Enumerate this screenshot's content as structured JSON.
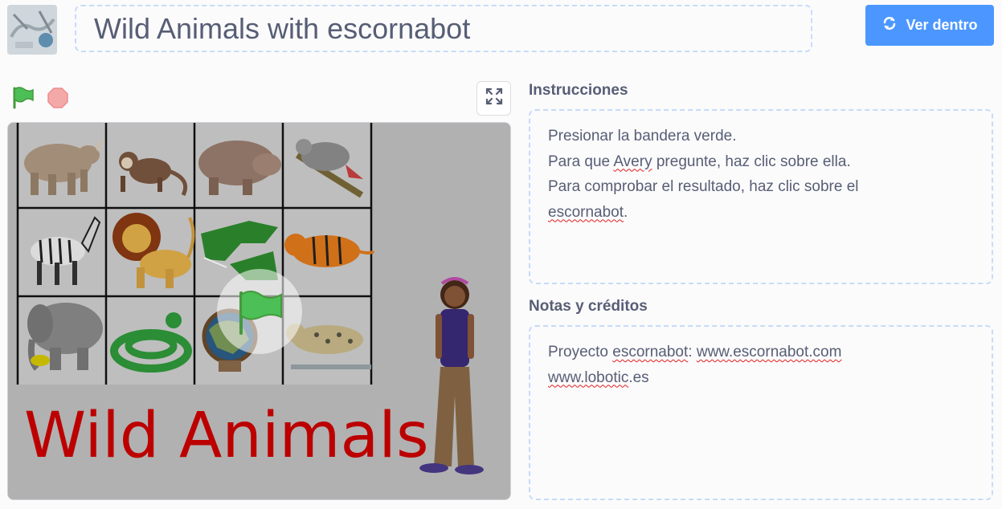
{
  "project": {
    "title": "Wild Animals with escornabot",
    "see_inside_label": "Ver dentro"
  },
  "player": {
    "green_flag_icon": "green-flag-icon",
    "stop_icon": "stop-icon",
    "fullscreen_icon": "fullscreen-icon",
    "stage_caption": "Wild Animals",
    "grid_animals": [
      "rhinoceros",
      "monkey",
      "hippopotamus",
      "parrot",
      "zebra",
      "lion",
      "crocodile",
      "tiger",
      "elephant",
      "snake",
      "globe",
      "leopard"
    ],
    "sprite": "Avery"
  },
  "instructions": {
    "heading": "Instrucciones",
    "lines": [
      {
        "pre": "Presionar la bandera verde.",
        "mark": "",
        "post": ""
      },
      {
        "pre": "Para que ",
        "mark": "Avery",
        "post": " pregunte, haz clic sobre ella."
      },
      {
        "pre": "Para comprobar el resultado, haz clic sobre el",
        "mark": "",
        "post": ""
      },
      {
        "pre": "",
        "mark": "escornabot",
        "post": "."
      }
    ]
  },
  "notes": {
    "heading": "Notas y créditos",
    "line1_pre": "Proyecto ",
    "line1_mark1": "escornabot",
    "line1_mid": ": ",
    "line1_mark2": "www.escornabot.com",
    "line2_mark": "www.lobotic",
    "line2_post": ".es"
  },
  "colors": {
    "accent": "#4c97ff",
    "text": "#575e75",
    "flag_green": "#4cbf56",
    "stop_red": "#ec5959",
    "caption_red": "#cc0000"
  }
}
